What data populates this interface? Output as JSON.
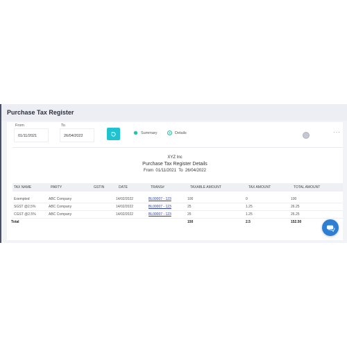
{
  "page": {
    "title": "Purchase Tax Register"
  },
  "filters": {
    "from_label": "From",
    "from_value": "01/11/2021",
    "to_label": "To",
    "to_value": "26/04/2022",
    "view_options": [
      {
        "label": "Summary",
        "selected": false
      },
      {
        "label": "Details",
        "selected": true
      }
    ]
  },
  "report": {
    "company": "XYZ Inc",
    "title": "Purchase Tax Register Details",
    "range_prefix": "From",
    "range_from": "01/11/2021",
    "range_to_label": "To",
    "range_to": "26/04/2022"
  },
  "table": {
    "columns": [
      "TAX NAME",
      "PARTY",
      "GSTIN",
      "DATE",
      "TRANS#",
      "TAXABLE AMOUNT",
      "TAX AMOUNT",
      "TOTAL AMOUNT"
    ],
    "rows": [
      {
        "tax_name": "Exempted",
        "party": "ABC Company",
        "gstin": "",
        "date": "14/02/2022",
        "trans": "BL00007 - 123",
        "taxable": "100",
        "tax": "0",
        "total": "100"
      },
      {
        "tax_name": "SGST @2.5%",
        "party": "ABC Company",
        "gstin": "",
        "date": "14/02/2022",
        "trans": "BL00007 - 123",
        "taxable": "25",
        "tax": "1.25",
        "total": "26.25"
      },
      {
        "tax_name": "CGST @2.5%",
        "party": "ABC Company",
        "gstin": "",
        "date": "14/02/2022",
        "trans": "BL00007 - 123",
        "taxable": "25",
        "tax": "1.25",
        "total": "26.25"
      }
    ],
    "total": {
      "label": "Total",
      "taxable": "150",
      "tax": "2.5",
      "total": "152.50"
    }
  },
  "colors": {
    "accent": "#1ec3cf",
    "radio": "#21c2a5",
    "link": "#2b3ea8",
    "chat": "#2d7fd3"
  },
  "icons": {
    "refresh": "refresh-icon",
    "chat": "chat-icon",
    "more": "more-icon"
  }
}
